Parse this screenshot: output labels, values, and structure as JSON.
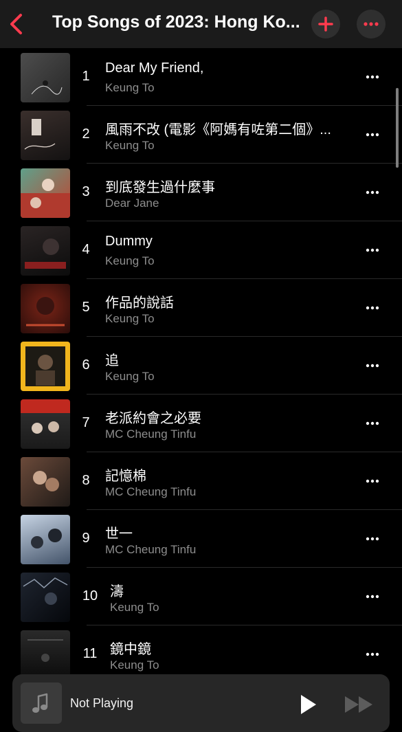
{
  "header": {
    "title": "Top Songs of 2023: Hong Ko...",
    "back_icon": "chevron-left-icon",
    "add_icon": "plus-icon",
    "more_icon": "ellipsis-icon"
  },
  "colors": {
    "accent": "#ff3b4e",
    "background": "#000000",
    "secondary_text": "#8d8d8d"
  },
  "songs": [
    {
      "rank": "1",
      "title": "Dear My Friend,",
      "artist": "Keung To"
    },
    {
      "rank": "2",
      "title": "風雨不改 (電影《阿媽有咗第二個》...",
      "artist": "Keung To"
    },
    {
      "rank": "3",
      "title": "到底發生過什麼事",
      "artist": "Dear Jane"
    },
    {
      "rank": "4",
      "title": "Dummy",
      "artist": "Keung To"
    },
    {
      "rank": "5",
      "title": "作品的說話",
      "artist": "Keung To"
    },
    {
      "rank": "6",
      "title": "追",
      "artist": "Keung To"
    },
    {
      "rank": "7",
      "title": "老派約會之必要",
      "artist": "MC Cheung Tinfu"
    },
    {
      "rank": "8",
      "title": "記憶棉",
      "artist": "MC Cheung Tinfu"
    },
    {
      "rank": "9",
      "title": "世一",
      "artist": "MC Cheung Tinfu"
    },
    {
      "rank": "10",
      "title": "濤",
      "artist": "Keung To"
    },
    {
      "rank": "11",
      "title": "鏡中鏡",
      "artist": "Keung To"
    }
  ],
  "mini_player": {
    "title": "Not Playing",
    "play_icon": "play-icon",
    "forward_icon": "fast-forward-icon",
    "artwork_icon": "music-note-icon"
  }
}
